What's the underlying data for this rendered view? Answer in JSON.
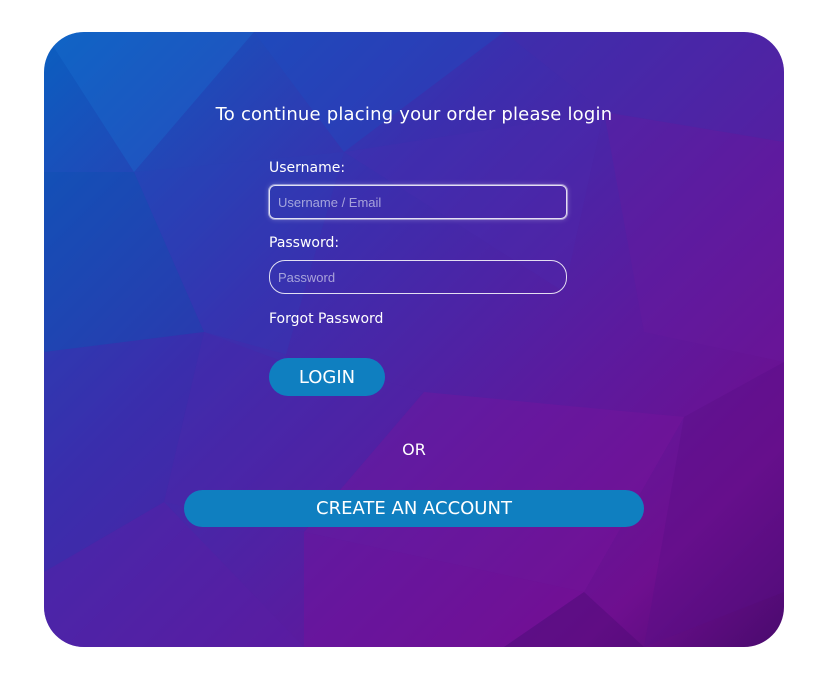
{
  "login": {
    "title": "To continue placing your order please login",
    "username_label": "Username:",
    "username_placeholder": "Username / Email",
    "username_value": "",
    "password_label": "Password:",
    "password_placeholder": "Password",
    "password_value": "",
    "forgot_password": "Forgot Password",
    "login_button": "LOGIN",
    "or_divider": "OR",
    "create_account_button": "CREATE AN ACCOUNT"
  },
  "colors": {
    "gradient_start": "#0a5fc0",
    "gradient_mid": "#5c1a9e",
    "gradient_end": "#6e0f8f",
    "button": "#0f7fc0",
    "text": "#ffffff"
  }
}
